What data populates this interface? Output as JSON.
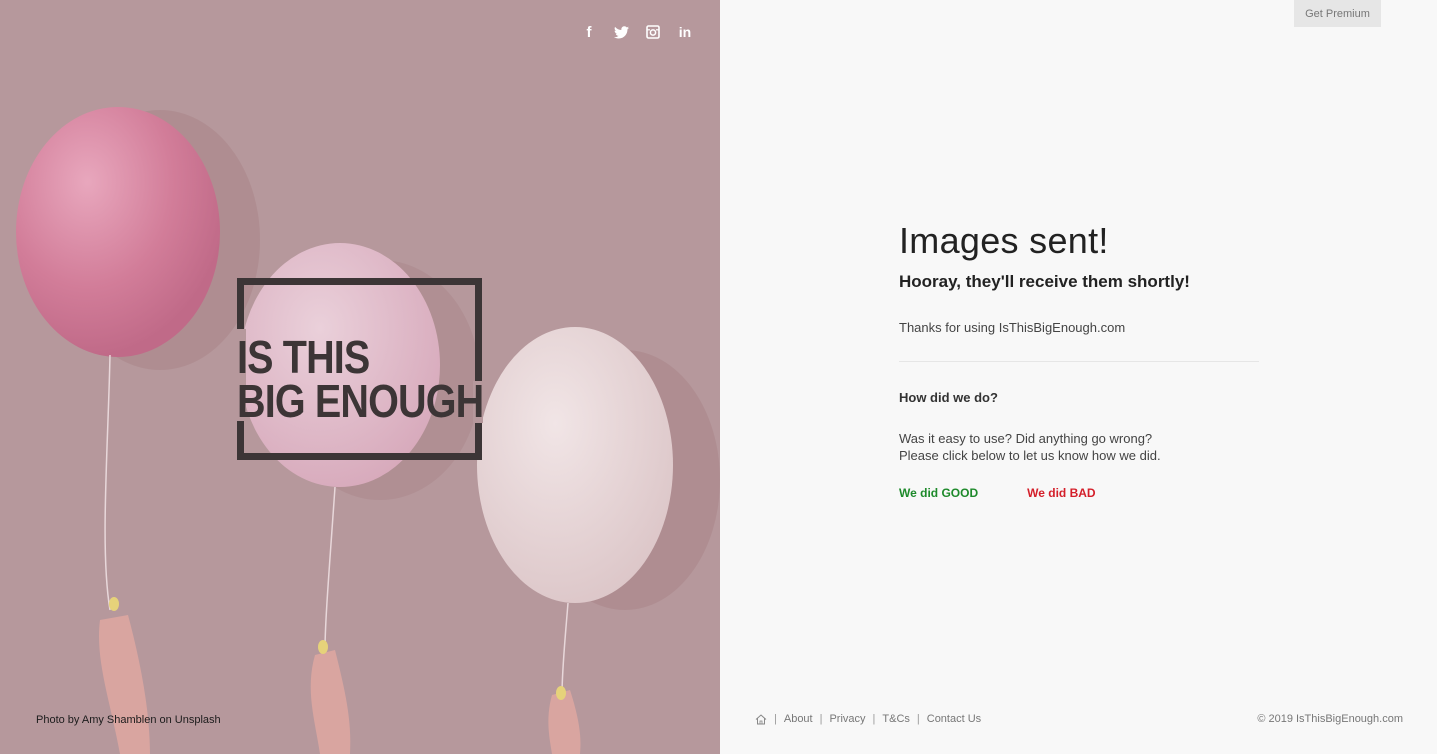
{
  "social": {
    "icons": [
      "facebook-icon",
      "twitter-icon",
      "instagram-icon",
      "linkedin-icon"
    ],
    "facebook_glyph": "f",
    "linkedin_glyph": "in"
  },
  "logo": {
    "line1": "IS THIS",
    "line2": "BIG ENOUGH",
    "color": "#3c3536"
  },
  "photo_credit": "Photo by Amy Shamblen on Unsplash",
  "premium_button": "Get Premium",
  "main": {
    "title": "Images sent!",
    "subtitle": "Hooray, they'll receive them shortly!",
    "thanks": "Thanks for using IsThisBigEnough.com",
    "question": "How did we do?",
    "ask_line1": "Was it easy to use? Did anything go wrong?",
    "ask_line2": "Please click below to let us know how we did.",
    "good_label": "We did GOOD",
    "bad_label": "We did BAD"
  },
  "colors": {
    "left_bg": "#b6989c",
    "good": "#1e8a2b",
    "bad": "#d41f2a"
  },
  "footer": {
    "home_icon": "home-icon",
    "separator": "|",
    "links": [
      "About",
      "Privacy",
      "T&Cs",
      "Contact Us"
    ],
    "copyright": "© 2019 IsThisBigEnough.com"
  }
}
